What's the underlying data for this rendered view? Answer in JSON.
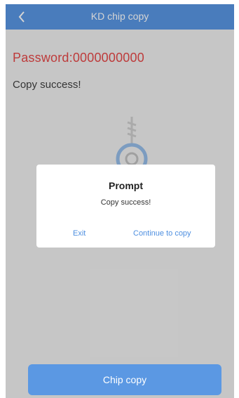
{
  "header": {
    "title": "KD chip copy",
    "back_icon": "chevron-left-icon"
  },
  "main": {
    "password_text": "Password:0000000000",
    "status_text": "Copy success!",
    "illustration_icon": "key-icon"
  },
  "dialog": {
    "title": "Prompt",
    "message": "Copy success!",
    "exit_label": "Exit",
    "continue_label": "Continue to copy"
  },
  "footer": {
    "button_label": "Chip copy"
  },
  "colors": {
    "accent": "#4e8fe0",
    "password": "#e23b3b",
    "background": "#eeeeee"
  }
}
